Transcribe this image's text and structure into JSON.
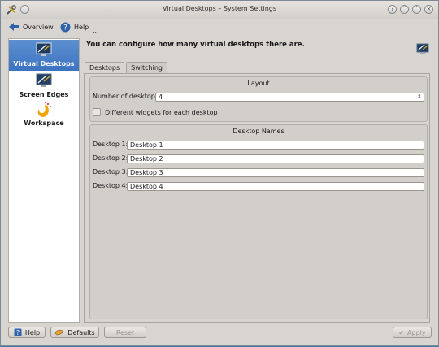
{
  "window": {
    "title": "Virtual Desktops – System Settings"
  },
  "toolbar": {
    "overview_label": "Overview",
    "help_label": "Help"
  },
  "sidebar": {
    "items": [
      {
        "label": "Virtual Desktops",
        "icon": "virtual-desktops-icon"
      },
      {
        "label": "Screen Edges",
        "icon": "screen-edges-icon"
      },
      {
        "label": "Workspace",
        "icon": "workspace-icon"
      }
    ]
  },
  "main": {
    "header_text": "You can configure how many virtual desktops there are.",
    "tabs": [
      {
        "label": "Desktops"
      },
      {
        "label": "Switching"
      }
    ],
    "layout": {
      "title": "Layout",
      "num_desktops_label": "Number of desktops:",
      "num_desktops_value": "4",
      "different_widgets_label": "Different widgets for each desktop"
    },
    "desktop_names": {
      "title": "Desktop Names",
      "rows": [
        {
          "label": "Desktop 1:",
          "value": "Desktop 1"
        },
        {
          "label": "Desktop 2:",
          "value": "Desktop 2"
        },
        {
          "label": "Desktop 3:",
          "value": "Desktop 3"
        },
        {
          "label": "Desktop 4:",
          "value": "Desktop 4"
        }
      ]
    }
  },
  "buttons": {
    "help": "Help",
    "defaults": "Defaults",
    "reset": "Reset",
    "apply": "Apply"
  },
  "colors": {
    "accent": "#3c74c2",
    "window_bg": "#d8d5d1"
  }
}
